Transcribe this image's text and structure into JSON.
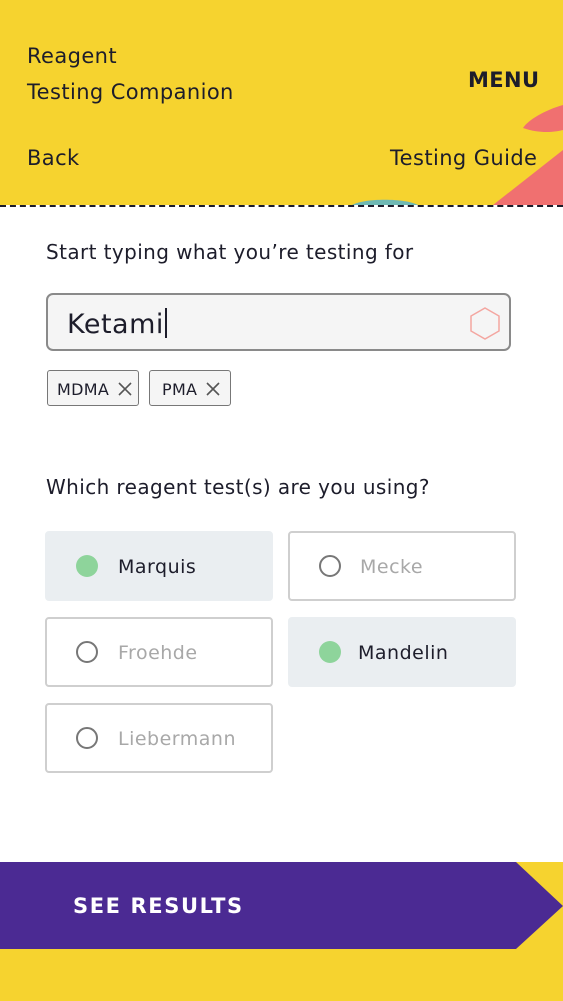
{
  "header": {
    "title_line1": "Reagent",
    "title_line2": "Testing Companion",
    "menu_label": "MENU",
    "back_label": "Back",
    "guide_label": "Testing Guide"
  },
  "search": {
    "prompt": "Start typing what you’re testing for",
    "value": "Ketami",
    "selected_substances": [
      "MDMA",
      "PMA"
    ]
  },
  "reagents": {
    "prompt": "Which reagent test(s) are you using?",
    "options": [
      {
        "label": "Marquis",
        "selected": true
      },
      {
        "label": "Mecke",
        "selected": false
      },
      {
        "label": "Froehde",
        "selected": false
      },
      {
        "label": "Mandelin",
        "selected": true
      },
      {
        "label": "Liebermann",
        "selected": false
      }
    ]
  },
  "action": {
    "see_results_label": "SEE RESULTS"
  },
  "colors": {
    "brand_yellow": "#f6d32f",
    "accent_purple": "#4b2a93",
    "accent_coral": "#f07070",
    "selected_green": "#8ed49b",
    "text_dark": "#1d1d2b"
  }
}
